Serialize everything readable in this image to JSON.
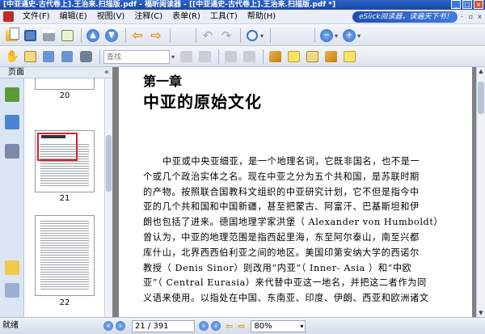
{
  "window": {
    "title": "[中亚通史-古代卷上].王治来.扫描版.pdf - 福昕阅读器 - [[中亚通史-古代卷上].王治来.扫描版.pdf *]",
    "controls": [
      "_",
      "□",
      "x"
    ]
  },
  "menubar": {
    "items": [
      "文件(F)",
      "编辑(E)",
      "视图(V)",
      "注释(C)",
      "表单(R)",
      "工具(T)",
      "帮助(H)"
    ],
    "banner": "eSlick阅读器，读遍天下书！",
    "controls": [
      "-",
      "▫",
      "x"
    ]
  },
  "toolbar1": {
    "icons": [
      "open-icon",
      "save-icon",
      "print-icon",
      "email-icon",
      "previous-page-icon",
      "next-page-icon",
      "back-icon",
      "forward-icon",
      "extract-pages-icon",
      "undo-icon",
      "redo-icon",
      "zoom-in-icon",
      "page-icon",
      "page-icon",
      "zoom-out-minus-icon",
      "zoom-in-plus-icon"
    ]
  },
  "toolbar2": {
    "search_placeholder": "查找",
    "icons": [
      "hand-tool-icon",
      "select-text-icon",
      "column-icon",
      "book-icon",
      "snapshot-icon",
      "annotation-icon",
      "note-icon",
      "highlight-icon",
      "pencil-icon"
    ]
  },
  "sidebar": {
    "header": "页面",
    "collapse": "«",
    "tabs": [
      "pages-tab",
      "bookmarks-tab",
      "layers-tab",
      "comments-tab",
      "attachments-tab"
    ],
    "thumbnails": [
      {
        "label": "20"
      },
      {
        "label": "21",
        "selected": true
      },
      {
        "label": "22"
      }
    ]
  },
  "document": {
    "chapter_label": "第一章",
    "chapter_title": "中亚的原始文化",
    "lines": [
      "中亚或中央亚细亚，是一个地理名词，它既非国名，也不是一",
      "个或几个政治实体之名。现在中亚之分为五个共和国，是苏联时期",
      "的产物。按照联合国教科文组织的中亚研究计划，它不但是指今中",
      "亚的几个共和国和中国新疆，甚至把蒙古、阿富汗、巴基斯坦和伊",
      "朗也包括了进来。德国地理学家洪堡（ Alexander von Humboldt）",
      "曾认为，中亚的地理范围是指西起里海，东至阿尔泰山，南至兴都",
      "库什山，北界西西伯利亚之间的地区。美国印第安纳大学的西诺尔",
      "教授（ Denis Sinor）则改用“内亚”（ Inner- Asia ）和“中欧",
      "亚”（ Central Eurasia）来代替中亚这一地名，并把这二者作为同",
      "义语来使用。以指处在中国、东南亚、印度、伊朗、西亚和欧洲诸文"
    ]
  },
  "statusbar": {
    "status": "就绪",
    "page_display": "21 / 391",
    "zoom": "80%"
  }
}
